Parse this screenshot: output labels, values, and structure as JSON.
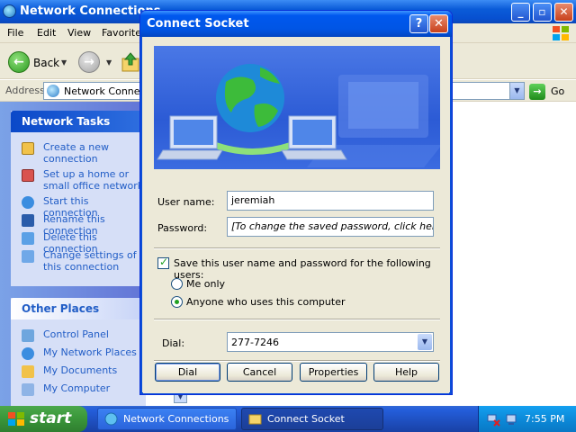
{
  "explorer": {
    "title": "Network Connections",
    "menu": [
      "File",
      "Edit",
      "View",
      "Favorite"
    ],
    "toolbar": {
      "back_label": "Back"
    },
    "address": {
      "label": "Address",
      "value": "Network Connect",
      "go_label": "Go"
    },
    "network_tasks": {
      "header": "Network Tasks",
      "items": [
        "Create a new connection",
        "Set up a home or small office network",
        "Start this connection",
        "Rename this connection",
        "Delete this connection",
        "Change settings of this connection"
      ]
    },
    "other_places": {
      "header": "Other Places",
      "items": [
        "Control Panel",
        "My Network Places",
        "My Documents",
        "My Computer"
      ]
    }
  },
  "dialog": {
    "title": "Connect Socket",
    "help_icon": "?",
    "user_name_label": "User name:",
    "user_name_value": "jeremiah",
    "password_label": "Password:",
    "password_value": "[To change the saved password, click here]",
    "save_checkbox_label": "Save this user name and password for the following users:",
    "save_checked": true,
    "radio_me_only": "Me only",
    "radio_anyone": "Anyone who uses this computer",
    "selected_radio": "anyone",
    "dial_label": "Dial:",
    "dial_value": "277-7246",
    "buttons": {
      "dial": "Dial",
      "cancel": "Cancel",
      "properties": "Properties",
      "help": "Help"
    }
  },
  "taskbar": {
    "start_label": "start",
    "tasks": [
      "Network Connections",
      "Connect Socket"
    ],
    "clock": "7:55 PM"
  },
  "colors": {
    "titlebar_blue": "#0055e5",
    "link_blue": "#215dc6",
    "taskbar_blue": "#245edb",
    "start_green": "#3c9a3c"
  }
}
